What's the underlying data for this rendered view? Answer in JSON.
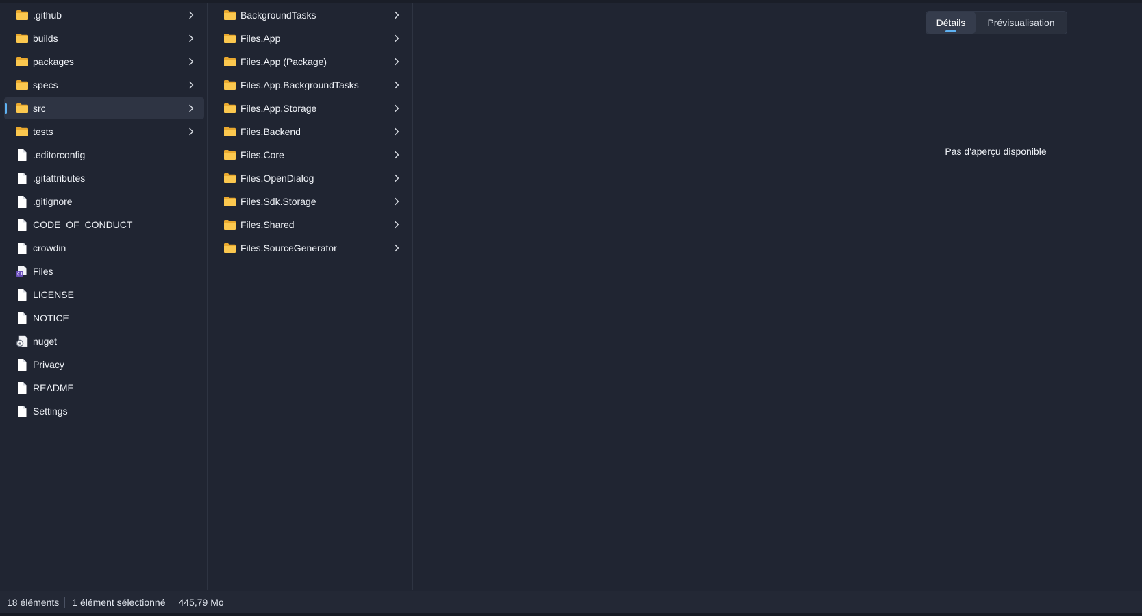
{
  "column1": {
    "items": [
      {
        "label": ".github",
        "type": "folder",
        "icon": "folder-icon",
        "chevron": true,
        "selected": false
      },
      {
        "label": "builds",
        "type": "folder",
        "icon": "folder-icon",
        "chevron": true,
        "selected": false
      },
      {
        "label": "packages",
        "type": "folder",
        "icon": "folder-icon",
        "chevron": true,
        "selected": false
      },
      {
        "label": "specs",
        "type": "folder",
        "icon": "folder-icon",
        "chevron": true,
        "selected": false
      },
      {
        "label": "src",
        "type": "folder",
        "icon": "folder-icon",
        "chevron": true,
        "selected": true
      },
      {
        "label": "tests",
        "type": "folder",
        "icon": "folder-icon",
        "chevron": true,
        "selected": false
      },
      {
        "label": ".editorconfig",
        "type": "file",
        "icon": "file-icon",
        "chevron": false,
        "selected": false
      },
      {
        "label": ".gitattributes",
        "type": "file",
        "icon": "file-icon",
        "chevron": false,
        "selected": false
      },
      {
        "label": ".gitignore",
        "type": "file",
        "icon": "file-icon",
        "chevron": false,
        "selected": false
      },
      {
        "label": "CODE_OF_CONDUCT",
        "type": "file",
        "icon": "file-icon",
        "chevron": false,
        "selected": false
      },
      {
        "label": "crowdin",
        "type": "file",
        "icon": "file-icon",
        "chevron": false,
        "selected": false
      },
      {
        "label": "Files",
        "type": "solution",
        "icon": "visual-studio-solution-icon",
        "chevron": false,
        "selected": false
      },
      {
        "label": "LICENSE",
        "type": "file",
        "icon": "file-icon",
        "chevron": false,
        "selected": false
      },
      {
        "label": "NOTICE",
        "type": "file",
        "icon": "file-icon",
        "chevron": false,
        "selected": false
      },
      {
        "label": "nuget",
        "type": "config",
        "icon": "config-file-icon",
        "chevron": false,
        "selected": false
      },
      {
        "label": "Privacy",
        "type": "file",
        "icon": "file-icon",
        "chevron": false,
        "selected": false
      },
      {
        "label": "README",
        "type": "file",
        "icon": "file-icon",
        "chevron": false,
        "selected": false
      },
      {
        "label": "Settings",
        "type": "file",
        "icon": "file-icon",
        "chevron": false,
        "selected": false
      }
    ]
  },
  "column2": {
    "items": [
      {
        "label": "BackgroundTasks",
        "type": "folder",
        "icon": "folder-icon",
        "chevron": true
      },
      {
        "label": "Files.App",
        "type": "folder",
        "icon": "folder-icon",
        "chevron": true
      },
      {
        "label": "Files.App (Package)",
        "type": "folder",
        "icon": "folder-icon",
        "chevron": true
      },
      {
        "label": "Files.App.BackgroundTasks",
        "type": "folder",
        "icon": "folder-icon",
        "chevron": true
      },
      {
        "label": "Files.App.Storage",
        "type": "folder",
        "icon": "folder-icon",
        "chevron": true
      },
      {
        "label": "Files.Backend",
        "type": "folder",
        "icon": "folder-icon",
        "chevron": true
      },
      {
        "label": "Files.Core",
        "type": "folder",
        "icon": "folder-icon",
        "chevron": true
      },
      {
        "label": "Files.OpenDialog",
        "type": "folder",
        "icon": "folder-icon",
        "chevron": true
      },
      {
        "label": "Files.Sdk.Storage",
        "type": "folder",
        "icon": "folder-icon",
        "chevron": true
      },
      {
        "label": "Files.Shared",
        "type": "folder",
        "icon": "folder-icon",
        "chevron": true
      },
      {
        "label": "Files.SourceGenerator",
        "type": "folder",
        "icon": "folder-icon",
        "chevron": true
      }
    ]
  },
  "preview": {
    "tabs": [
      {
        "label": "Détails",
        "active": true
      },
      {
        "label": "Prévisualisation",
        "active": false
      }
    ],
    "message": "Pas d'aperçu disponible"
  },
  "status": {
    "item_count": "18 éléments",
    "selection": "1 élément sélectionné",
    "size": "445,79 Mo"
  },
  "colors": {
    "background": "#202532",
    "folder": "#f8c14a",
    "accent": "#5fb2f2"
  }
}
